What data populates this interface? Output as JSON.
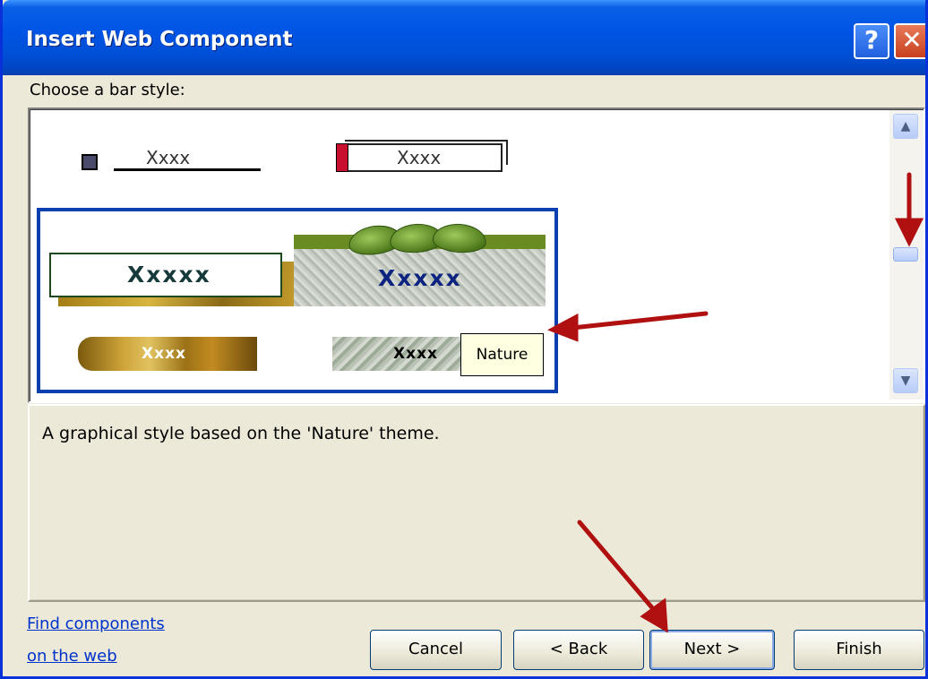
{
  "window": {
    "title": "Insert Web Component",
    "help_label": "?",
    "close_label": "✕"
  },
  "gallery": {
    "label": "Choose a bar style:",
    "styles": [
      {
        "text": "Xxxx"
      },
      {
        "text": "Xxxx"
      },
      {
        "text": "Xxxxx"
      },
      {
        "text": "Xxxxx"
      },
      {
        "text": "Xxxx"
      },
      {
        "text": "Xxxx"
      }
    ],
    "tooltip": "Nature"
  },
  "description": {
    "text": "A graphical style based on the 'Nature' theme."
  },
  "links": {
    "find_line1": "Find components",
    "find_line2": "on the web"
  },
  "buttons": {
    "cancel": "Cancel",
    "back": "< Back",
    "next": "Next >",
    "finish": "Finish"
  },
  "colors": {
    "titlebar": "#0055e5",
    "selection_border": "#0a3fb0",
    "annotation_arrow": "#b01010",
    "link": "#0033cc"
  }
}
